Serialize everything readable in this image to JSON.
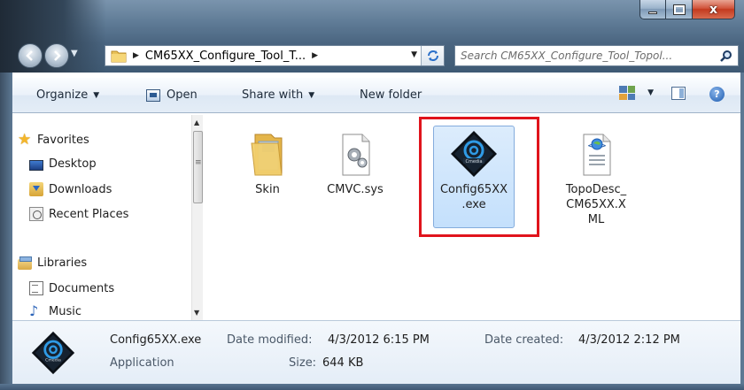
{
  "window": {
    "controls": {
      "minimize": "minimize",
      "maximize": "maximize",
      "close": "x"
    }
  },
  "nav": {
    "address": {
      "path_segment": "CM65XX_Configure_Tool_T...",
      "separator": "▶",
      "trail_arrow": "▶",
      "dropdown": "▼"
    },
    "search": {
      "placeholder": "Search CM65XX_Configure_Tool_Topol..."
    }
  },
  "commandbar": {
    "organize_label": "Organize",
    "open_label": "Open",
    "share_label": "Share with",
    "new_folder_label": "New folder",
    "caret": "▼"
  },
  "navpane": {
    "items": [
      {
        "label": "Favorites",
        "icon": "star-icon"
      },
      {
        "label": "Desktop",
        "icon": "desktop-icon"
      },
      {
        "label": "Downloads",
        "icon": "downloads-icon"
      },
      {
        "label": "Recent Places",
        "icon": "recent-places-icon"
      },
      {
        "label": "Libraries",
        "icon": "libraries-icon"
      },
      {
        "label": "Documents",
        "icon": "documents-icon"
      },
      {
        "label": "Music",
        "icon": "music-icon"
      }
    ]
  },
  "files": [
    {
      "name": "Skin",
      "type": "folder"
    },
    {
      "name": "CMVC.sys",
      "type": "system-file"
    },
    {
      "name_line1": "Config65XX",
      "name_line2": ".exe",
      "type": "application",
      "selected": true
    },
    {
      "name_line1": "TopoDesc_",
      "name_line2": "CM65XX.X",
      "name_line3": "ML",
      "type": "xml"
    }
  ],
  "details": {
    "filename": "Config65XX.exe",
    "type": "Application",
    "date_modified_label": "Date modified:",
    "date_modified": "4/3/2012 6:15 PM",
    "size_label": "Size:",
    "size": "644 KB",
    "date_created_label": "Date created:",
    "date_created": "4/3/2012 2:12 PM"
  },
  "colors": {
    "highlight": "#e0141c",
    "selection": "#c4e0fc",
    "accent": "#1c5bb0"
  }
}
